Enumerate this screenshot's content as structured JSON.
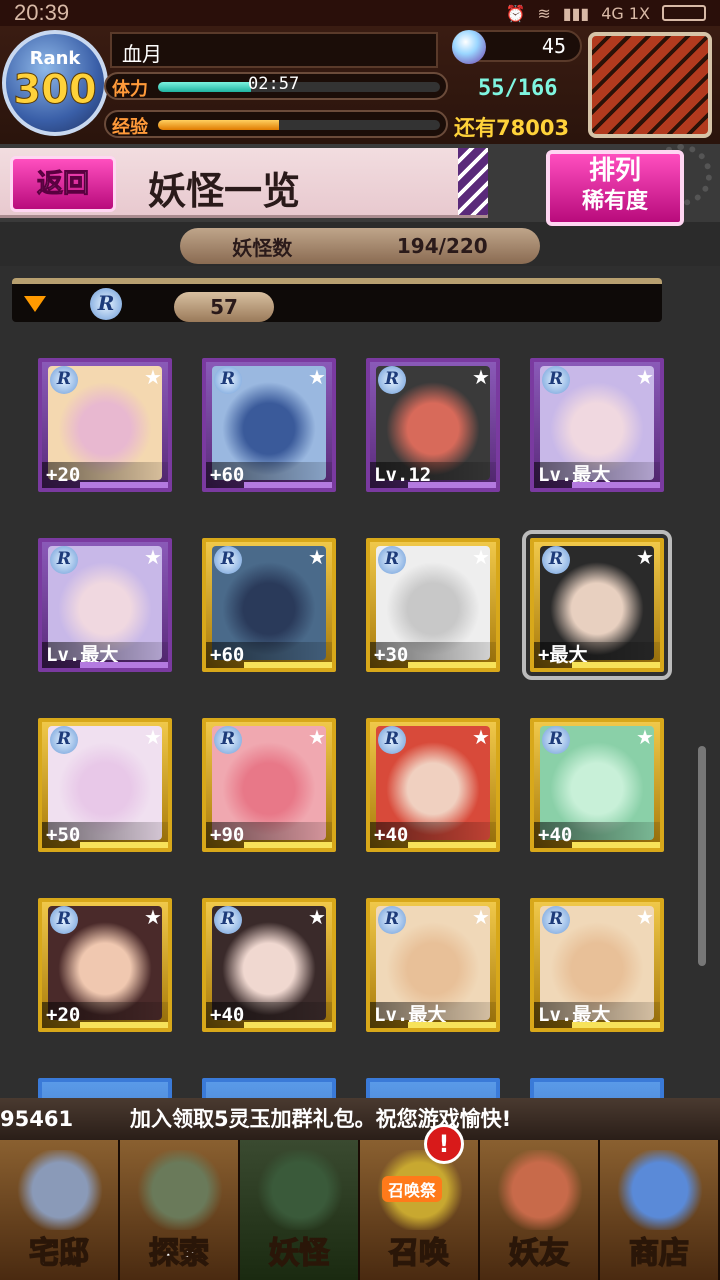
{
  "status_bar": {
    "time": "20:39",
    "network": "4G",
    "network_sub": "1X"
  },
  "header": {
    "rank_label": "Rank",
    "rank_value": "300",
    "player_name": "血月",
    "stamina_label": "体力",
    "stamina_timer": "02:57",
    "stamina_count": "55/166",
    "stamina_fraction": 0.33,
    "exp_label": "经验",
    "exp_fraction": 0.43,
    "exp_remaining": "还有78003",
    "gem_count": "45"
  },
  "titlebar": {
    "back_label": "返回",
    "title": "妖怪一览",
    "sort_line1": "排列",
    "sort_line2": "稀有度"
  },
  "count_bar": {
    "label": "妖怪数",
    "value": "194/220"
  },
  "group": {
    "rarity": "R",
    "count": "57"
  },
  "cards": [
    {
      "level": "+20",
      "frame": "purple"
    },
    {
      "level": "+60",
      "frame": "purple"
    },
    {
      "level": "Lv.12",
      "frame": "purple"
    },
    {
      "level": "Lv.最大",
      "frame": "purple"
    },
    {
      "level": "Lv.最大",
      "frame": "purple"
    },
    {
      "level": "+60",
      "frame": "gold"
    },
    {
      "level": "+30",
      "frame": "gold"
    },
    {
      "level": "+最大",
      "frame": "gold",
      "selected": true
    },
    {
      "level": "+50",
      "frame": "gold"
    },
    {
      "level": "+90",
      "frame": "gold"
    },
    {
      "level": "+40",
      "frame": "gold"
    },
    {
      "level": "+40",
      "frame": "gold"
    },
    {
      "level": "+20",
      "frame": "gold"
    },
    {
      "level": "+40",
      "frame": "gold"
    },
    {
      "level": "Lv.最大",
      "frame": "gold"
    },
    {
      "level": "Lv.最大",
      "frame": "gold"
    }
  ],
  "ticker": {
    "id": "95461",
    "message": "加入领取5灵玉加群礼包。祝您游戏愉快!"
  },
  "nav": [
    {
      "label": "宅邸",
      "icon": "mansion-icon"
    },
    {
      "label": "探索",
      "icon": "magnifier-map-icon"
    },
    {
      "label": "妖怪",
      "icon": "scroll-icon"
    },
    {
      "label": "召唤",
      "icon": "summon-star-icon",
      "tag": "召唤祭",
      "alert": "!"
    },
    {
      "label": "妖友",
      "icon": "friend-icon"
    },
    {
      "label": "商店",
      "icon": "crystal-orb-icon"
    }
  ]
}
